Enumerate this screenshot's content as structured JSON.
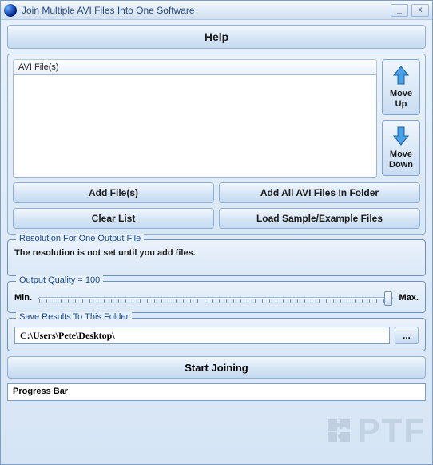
{
  "window": {
    "title": "Join Multiple AVI Files Into One Software",
    "minimize": "_",
    "close": "x"
  },
  "help_label": "Help",
  "file_list": {
    "header": "AVI File(s)"
  },
  "move_up_label": "Move\nUp",
  "move_down_label": "Move\nDown",
  "buttons": {
    "add_files": "Add File(s)",
    "add_folder": "Add All AVI Files In Folder",
    "clear_list": "Clear List",
    "load_sample": "Load Sample/Example Files"
  },
  "resolution": {
    "legend": "Resolution For One Output File",
    "text": "The resolution is not set until you add files."
  },
  "quality": {
    "legend": "Output Quality = 100",
    "min": "Min.",
    "max": "Max.",
    "value": 100
  },
  "save": {
    "legend": "Save Results To This Folder",
    "path": "C:\\Users\\Pete\\Desktop\\",
    "browse": "..."
  },
  "start_label": "Start Joining",
  "progress_label": "Progress Bar",
  "watermark": "PTF"
}
